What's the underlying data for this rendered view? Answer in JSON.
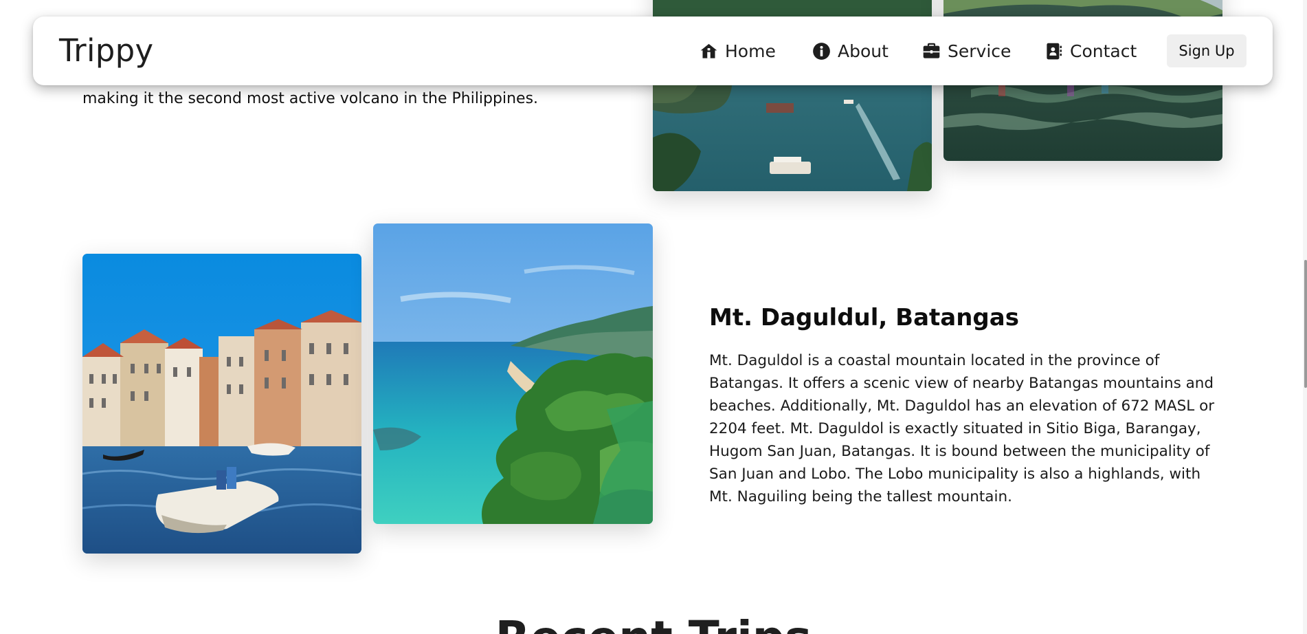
{
  "navbar": {
    "brand": "Trippy",
    "items": [
      {
        "label": "Home",
        "icon": "house-icon"
      },
      {
        "label": "About",
        "icon": "info-circle-icon"
      },
      {
        "label": "Service",
        "icon": "briefcase-icon"
      },
      {
        "label": "Contact",
        "icon": "address-book-icon"
      }
    ],
    "signup_label": "Sign Up"
  },
  "previous_destination": {
    "text_tail": "making it the second most active volcano in the Philippines."
  },
  "destination": {
    "title": "Mt. Daguldul, Batangas",
    "description": "Mt. Daguldol is a coastal mountain located in the province of Batangas. It offers a scenic view of nearby Batangas mountains and beaches. Additionally, Mt. Daguldol has an elevation of 672 MASL or 2204 feet. Mt. Daguldol is exactly situated in Sitio Biga, Barangay, Hugom San Juan, Batangas. It is bound between the municipality of San Juan and Lobo. The Lobo municipality is also a highlands, with Mt. Naguiling being the tallest mountain."
  },
  "recent_trips": {
    "heading": "Recent Trips"
  },
  "colors": {
    "navbar_bg": "#ffffff",
    "signup_bg": "#efefef",
    "text": "#151515"
  }
}
